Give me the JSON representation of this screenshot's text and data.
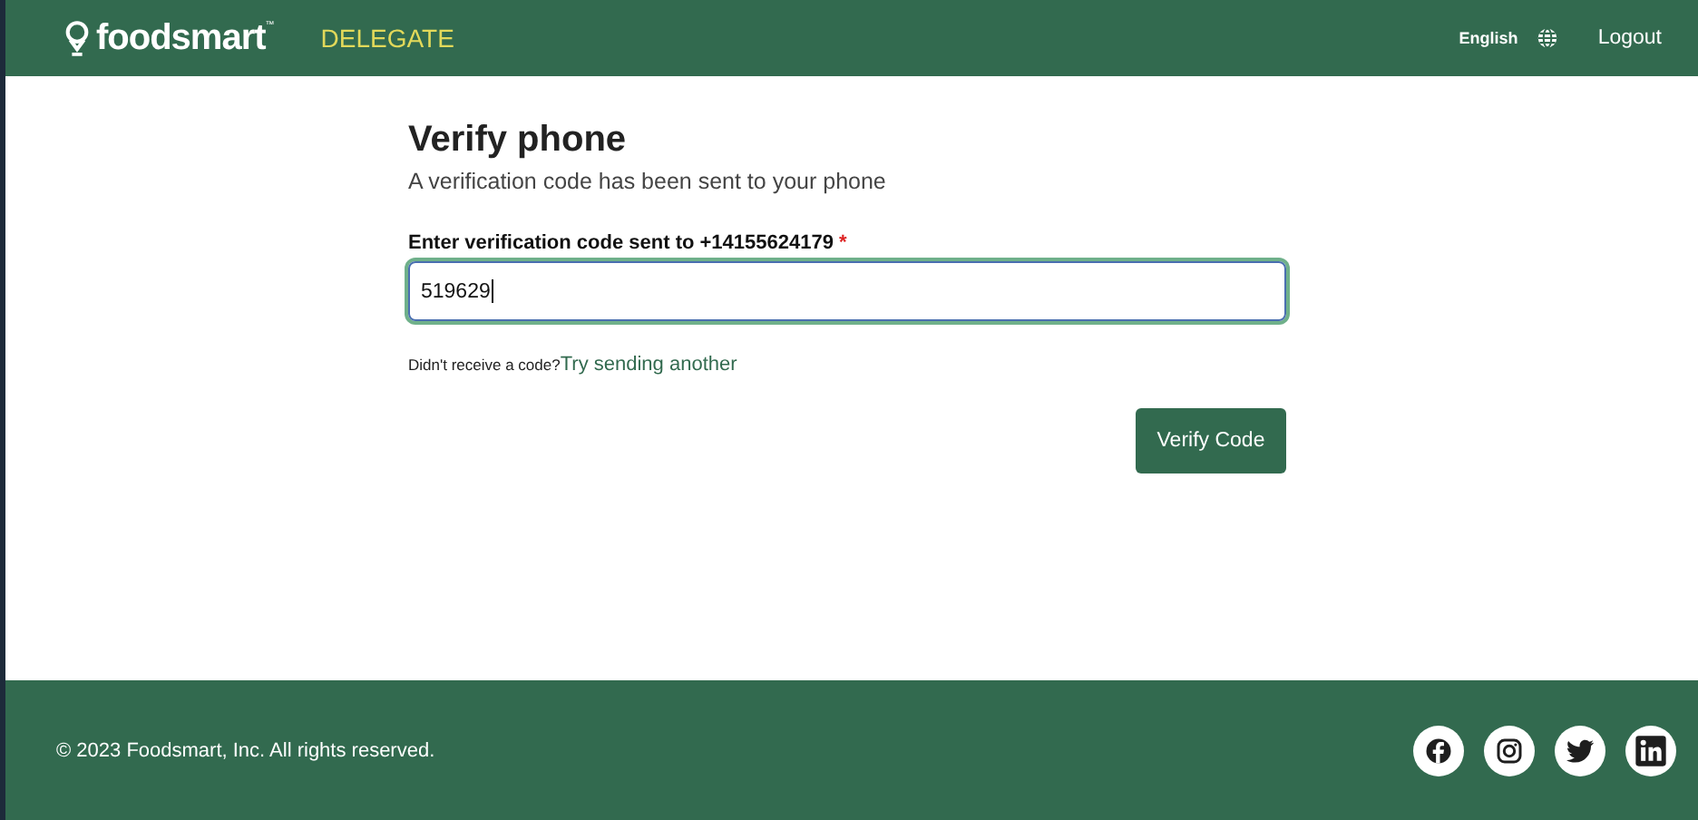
{
  "header": {
    "brand": "foodsmart$^{™}$",
    "section": "DELEGATE",
    "language": "English",
    "logout": "Logout"
  },
  "form": {
    "title": "Verify phone",
    "subtitle": "A verification code has been sent to your phone",
    "field": {
      "label": "Enter verification code sent to +14155624179",
      "required_mark": "*",
      "value": "519629",
      "focused": true
    },
    "resend_prompt": "Didn't receive a code?",
    "resend_link": "Try sending another",
    "submit": "Verify Code"
  },
  "footer": {
    "copyright": "© 2023 Foodsmart, Inc. All rights reserved.",
    "social_links": [
      {
        "kind": "facebook"
      },
      {
        "kind": "instagram"
      },
      {
        "kind": "twitter"
      },
      {
        "kind": "linkedin"
      }
    ]
  }
}
